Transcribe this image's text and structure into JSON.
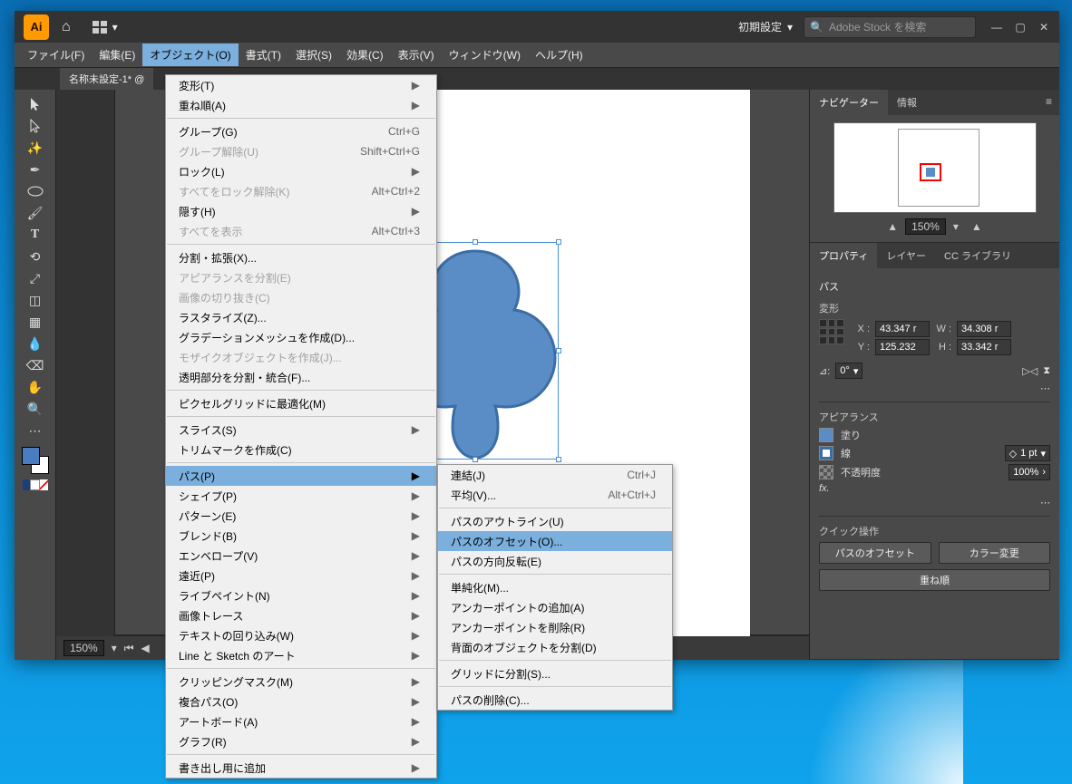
{
  "titlebar": {
    "logo": "Ai",
    "preset_label": "初期設定",
    "search_placeholder": "Adobe Stock を検索"
  },
  "menubar": {
    "file": "ファイル(F)",
    "edit": "編集(E)",
    "object": "オブジェクト(O)",
    "type": "書式(T)",
    "select": "選択(S)",
    "effect": "効果(C)",
    "view": "表示(V)",
    "window": "ウィンドウ(W)",
    "help": "ヘルプ(H)"
  },
  "doc_tab": "名称未設定-1* @",
  "status": {
    "zoom": "150%"
  },
  "navigator": {
    "tab1": "ナビゲーター",
    "tab2": "情報",
    "zoom": "150%"
  },
  "props": {
    "tab1": "プロパティ",
    "tab2": "レイヤー",
    "tab3": "CC ライブラリ",
    "selection": "パス",
    "transform_title": "変形",
    "x_label": "X :",
    "x_val": "43.347 r",
    "y_label": "Y :",
    "y_val": "125.232",
    "w_label": "W :",
    "w_val": "34.308 r",
    "h_label": "H :",
    "h_val": "33.342 r",
    "angle": "0°",
    "appearance_title": "アピアランス",
    "fill_label": "塗り",
    "stroke_label": "線",
    "stroke_val": "1 pt",
    "opacity_label": "不透明度",
    "opacity_val": "100%",
    "fx_label": "fx.",
    "quick_title": "クイック操作",
    "btn_offset": "パスのオフセット",
    "btn_recolor": "カラー変更",
    "btn_arrange": "重ね順"
  },
  "obj_menu": [
    {
      "t": "item",
      "label": "変形(T)",
      "arrow": true
    },
    {
      "t": "item",
      "label": "重ね順(A)",
      "arrow": true
    },
    {
      "t": "sep"
    },
    {
      "t": "item",
      "label": "グループ(G)",
      "short": "Ctrl+G"
    },
    {
      "t": "item",
      "label": "グループ解除(U)",
      "short": "Shift+Ctrl+G",
      "disabled": true
    },
    {
      "t": "item",
      "label": "ロック(L)",
      "arrow": true
    },
    {
      "t": "item",
      "label": "すべてをロック解除(K)",
      "short": "Alt+Ctrl+2",
      "disabled": true
    },
    {
      "t": "item",
      "label": "隠す(H)",
      "arrow": true
    },
    {
      "t": "item",
      "label": "すべてを表示",
      "short": "Alt+Ctrl+3",
      "disabled": true
    },
    {
      "t": "sep"
    },
    {
      "t": "item",
      "label": "分割・拡張(X)..."
    },
    {
      "t": "item",
      "label": "アピアランスを分割(E)",
      "disabled": true
    },
    {
      "t": "item",
      "label": "画像の切り抜き(C)",
      "disabled": true
    },
    {
      "t": "item",
      "label": "ラスタライズ(Z)..."
    },
    {
      "t": "item",
      "label": "グラデーションメッシュを作成(D)..."
    },
    {
      "t": "item",
      "label": "モザイクオブジェクトを作成(J)...",
      "disabled": true
    },
    {
      "t": "item",
      "label": "透明部分を分割・統合(F)..."
    },
    {
      "t": "sep"
    },
    {
      "t": "item",
      "label": "ピクセルグリッドに最適化(M)"
    },
    {
      "t": "sep"
    },
    {
      "t": "item",
      "label": "スライス(S)",
      "arrow": true
    },
    {
      "t": "item",
      "label": "トリムマークを作成(C)"
    },
    {
      "t": "sep"
    },
    {
      "t": "item",
      "label": "パス(P)",
      "arrow": true,
      "sel": true
    },
    {
      "t": "item",
      "label": "シェイプ(P)",
      "arrow": true
    },
    {
      "t": "item",
      "label": "パターン(E)",
      "arrow": true
    },
    {
      "t": "item",
      "label": "ブレンド(B)",
      "arrow": true
    },
    {
      "t": "item",
      "label": "エンベロープ(V)",
      "arrow": true
    },
    {
      "t": "item",
      "label": "遠近(P)",
      "arrow": true
    },
    {
      "t": "item",
      "label": "ライブペイント(N)",
      "arrow": true
    },
    {
      "t": "item",
      "label": "画像トレース",
      "arrow": true
    },
    {
      "t": "item",
      "label": "テキストの回り込み(W)",
      "arrow": true
    },
    {
      "t": "item",
      "label": "Line と Sketch のアート",
      "arrow": true
    },
    {
      "t": "sep"
    },
    {
      "t": "item",
      "label": "クリッピングマスク(M)",
      "arrow": true
    },
    {
      "t": "item",
      "label": "複合パス(O)",
      "arrow": true
    },
    {
      "t": "item",
      "label": "アートボード(A)",
      "arrow": true
    },
    {
      "t": "item",
      "label": "グラフ(R)",
      "arrow": true
    },
    {
      "t": "sep"
    },
    {
      "t": "item",
      "label": "書き出し用に追加",
      "arrow": true
    }
  ],
  "path_menu": [
    {
      "t": "item",
      "label": "連結(J)",
      "short": "Ctrl+J"
    },
    {
      "t": "item",
      "label": "平均(V)...",
      "short": "Alt+Ctrl+J"
    },
    {
      "t": "sep"
    },
    {
      "t": "item",
      "label": "パスのアウトライン(U)"
    },
    {
      "t": "item",
      "label": "パスのオフセット(O)...",
      "sel": true
    },
    {
      "t": "item",
      "label": "パスの方向反転(E)"
    },
    {
      "t": "sep"
    },
    {
      "t": "item",
      "label": "単純化(M)..."
    },
    {
      "t": "item",
      "label": "アンカーポイントの追加(A)"
    },
    {
      "t": "item",
      "label": "アンカーポイントを削除(R)"
    },
    {
      "t": "item",
      "label": "背面のオブジェクトを分割(D)"
    },
    {
      "t": "sep"
    },
    {
      "t": "item",
      "label": "グリッドに分割(S)..."
    },
    {
      "t": "sep"
    },
    {
      "t": "item",
      "label": "パスの削除(C)..."
    }
  ]
}
